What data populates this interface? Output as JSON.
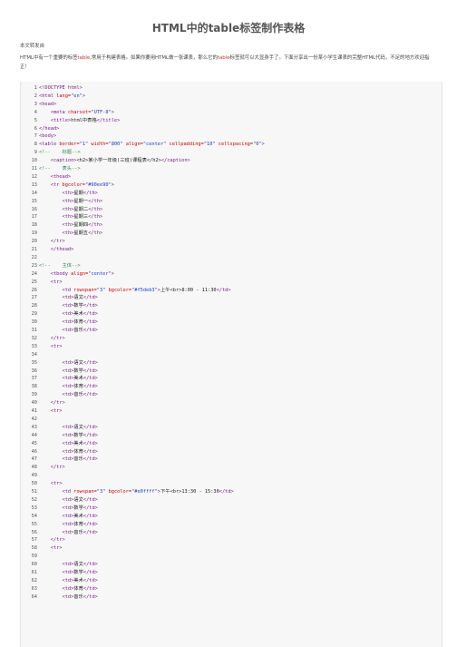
{
  "doc": {
    "title": "HTML中的table标签制作表格",
    "meta": "本文转发自",
    "intro_parts": [
      {
        "t": "HTML中有一个重要的标签",
        "c": ""
      },
      {
        "t": "table",
        "c": "red"
      },
      {
        "t": ",常用于构建表格。如果你要用HTML做一张课表，那么它的",
        "c": ""
      },
      {
        "t": "table",
        "c": "red"
      },
      {
        "t": "标签就可以大显身手了。下面分享出一份某小学生课表的完整HTML代码，不足的地方欢迎指正！",
        "c": ""
      }
    ]
  },
  "code_lines": [
    [
      [
        "tag",
        "<!DOCTYPE html>"
      ]
    ],
    [
      [
        "tag",
        "<html "
      ],
      [
        "attr",
        "lang="
      ],
      [
        "val",
        "\"en\""
      ],
      [
        "tag",
        ">"
      ]
    ],
    [
      [
        "tag",
        "<head>"
      ]
    ],
    [
      [
        "txt",
        "    "
      ],
      [
        "tag",
        "<meta "
      ],
      [
        "attr",
        "charset="
      ],
      [
        "val",
        "\"UTF-8\""
      ],
      [
        "tag",
        ">"
      ]
    ],
    [
      [
        "txt",
        "    "
      ],
      [
        "tag",
        "<title>"
      ],
      [
        "txt",
        "html中表格"
      ],
      [
        "tag",
        "</title>"
      ]
    ],
    [
      [
        "tag",
        "</head>"
      ]
    ],
    [
      [
        "tag",
        "<body>"
      ]
    ],
    [
      [
        "tag",
        "<table "
      ],
      [
        "attr",
        "border="
      ],
      [
        "val",
        "\"1\" "
      ],
      [
        "attr",
        "width="
      ],
      [
        "val",
        "\"800\" "
      ],
      [
        "attr",
        "align="
      ],
      [
        "val",
        "\"center\" "
      ],
      [
        "attr",
        "cellpadding="
      ],
      [
        "val",
        "\"10\" "
      ],
      [
        "attr",
        "cellspacing="
      ],
      [
        "val",
        "\"0\""
      ],
      [
        "tag",
        ">"
      ]
    ],
    [
      [
        "cmt",
        "<!--    标题-->"
      ]
    ],
    [
      [
        "txt",
        "    "
      ],
      [
        "tag",
        "<caption>"
      ],
      [
        "txt",
        "<h2>某小学一年级(三班)课程表</h2>"
      ],
      [
        "tag",
        "</caption>"
      ]
    ],
    [
      [
        "cmt",
        "<!--    表头-->"
      ]
    ],
    [
      [
        "txt",
        "    "
      ],
      [
        "tag",
        "<thead>"
      ]
    ],
    [
      [
        "txt",
        "    "
      ],
      [
        "tag",
        "<tr "
      ],
      [
        "attr",
        "bgcolor="
      ],
      [
        "val",
        "\"#90ee90\""
      ],
      [
        "tag",
        ">"
      ]
    ],
    [
      [
        "txt",
        "        "
      ],
      [
        "tag",
        "<th>"
      ],
      [
        "txt",
        "星期"
      ],
      [
        "tag",
        "</th>"
      ]
    ],
    [
      [
        "txt",
        "        "
      ],
      [
        "tag",
        "<th>"
      ],
      [
        "txt",
        "星期一"
      ],
      [
        "tag",
        "</th>"
      ]
    ],
    [
      [
        "txt",
        "        "
      ],
      [
        "tag",
        "<th>"
      ],
      [
        "txt",
        "星期二"
      ],
      [
        "tag",
        "</th>"
      ]
    ],
    [
      [
        "txt",
        "        "
      ],
      [
        "tag",
        "<th>"
      ],
      [
        "txt",
        "星期三"
      ],
      [
        "tag",
        "</th>"
      ]
    ],
    [
      [
        "txt",
        "        "
      ],
      [
        "tag",
        "<th>"
      ],
      [
        "txt",
        "星期四"
      ],
      [
        "tag",
        "</th>"
      ]
    ],
    [
      [
        "txt",
        "        "
      ],
      [
        "tag",
        "<th>"
      ],
      [
        "txt",
        "星期五"
      ],
      [
        "tag",
        "</th>"
      ]
    ],
    [
      [
        "txt",
        "    "
      ],
      [
        "tag",
        "</tr>"
      ]
    ],
    [
      [
        "txt",
        "    "
      ],
      [
        "tag",
        "</thead>"
      ]
    ],
    [],
    [
      [
        "cmt",
        "<!--    主体-->"
      ]
    ],
    [
      [
        "txt",
        "    "
      ],
      [
        "tag",
        "<tbody "
      ],
      [
        "attr",
        "align="
      ],
      [
        "val",
        "\"center\""
      ],
      [
        "tag",
        ">"
      ]
    ],
    [
      [
        "txt",
        "    "
      ],
      [
        "tag",
        "<tr>"
      ]
    ],
    [
      [
        "txt",
        "        "
      ],
      [
        "tag",
        "<td "
      ],
      [
        "attr",
        "rowspan="
      ],
      [
        "val",
        "\"3\" "
      ],
      [
        "attr",
        "bgcolor="
      ],
      [
        "val",
        "\"#f5deb3\""
      ],
      [
        "tag",
        ">"
      ],
      [
        "txt",
        "上午<br>8:00 - 11:30"
      ],
      [
        "tag",
        "</td>"
      ]
    ],
    [
      [
        "txt",
        "        "
      ],
      [
        "tag",
        "<td>"
      ],
      [
        "txt",
        "语文"
      ],
      [
        "tag",
        "</td>"
      ]
    ],
    [
      [
        "txt",
        "        "
      ],
      [
        "tag",
        "<td>"
      ],
      [
        "txt",
        "数学"
      ],
      [
        "tag",
        "</td>"
      ]
    ],
    [
      [
        "txt",
        "        "
      ],
      [
        "tag",
        "<td>"
      ],
      [
        "txt",
        "美术"
      ],
      [
        "tag",
        "</td>"
      ]
    ],
    [
      [
        "txt",
        "        "
      ],
      [
        "tag",
        "<td>"
      ],
      [
        "txt",
        "体育"
      ],
      [
        "tag",
        "</td>"
      ]
    ],
    [
      [
        "txt",
        "        "
      ],
      [
        "tag",
        "<td>"
      ],
      [
        "txt",
        "音乐"
      ],
      [
        "tag",
        "</td>"
      ]
    ],
    [
      [
        "txt",
        "    "
      ],
      [
        "tag",
        "</tr>"
      ]
    ],
    [
      [
        "txt",
        "    "
      ],
      [
        "tag",
        "<tr>"
      ]
    ],
    [],
    [
      [
        "txt",
        "        "
      ],
      [
        "tag",
        "<td>"
      ],
      [
        "txt",
        "语文"
      ],
      [
        "tag",
        "</td>"
      ]
    ],
    [
      [
        "txt",
        "        "
      ],
      [
        "tag",
        "<td>"
      ],
      [
        "txt",
        "数学"
      ],
      [
        "tag",
        "</td>"
      ]
    ],
    [
      [
        "txt",
        "        "
      ],
      [
        "tag",
        "<td>"
      ],
      [
        "txt",
        "美术"
      ],
      [
        "tag",
        "</td>"
      ]
    ],
    [
      [
        "txt",
        "        "
      ],
      [
        "tag",
        "<td>"
      ],
      [
        "txt",
        "体育"
      ],
      [
        "tag",
        "</td>"
      ]
    ],
    [
      [
        "txt",
        "        "
      ],
      [
        "tag",
        "<td>"
      ],
      [
        "txt",
        "音乐"
      ],
      [
        "tag",
        "</td>"
      ]
    ],
    [
      [
        "txt",
        "    "
      ],
      [
        "tag",
        "</tr>"
      ]
    ],
    [
      [
        "txt",
        "    "
      ],
      [
        "tag",
        "<tr>"
      ]
    ],
    [],
    [
      [
        "txt",
        "        "
      ],
      [
        "tag",
        "<td>"
      ],
      [
        "txt",
        "语文"
      ],
      [
        "tag",
        "</td>"
      ]
    ],
    [
      [
        "txt",
        "        "
      ],
      [
        "tag",
        "<td>"
      ],
      [
        "txt",
        "数学"
      ],
      [
        "tag",
        "</td>"
      ]
    ],
    [
      [
        "txt",
        "        "
      ],
      [
        "tag",
        "<td>"
      ],
      [
        "txt",
        "美术"
      ],
      [
        "tag",
        "</td>"
      ]
    ],
    [
      [
        "txt",
        "        "
      ],
      [
        "tag",
        "<td>"
      ],
      [
        "txt",
        "体育"
      ],
      [
        "tag",
        "</td>"
      ]
    ],
    [
      [
        "txt",
        "        "
      ],
      [
        "tag",
        "<td>"
      ],
      [
        "txt",
        "音乐"
      ],
      [
        "tag",
        "</td>"
      ]
    ],
    [
      [
        "txt",
        "    "
      ],
      [
        "tag",
        "</tr>"
      ]
    ],
    [],
    [
      [
        "txt",
        "    "
      ],
      [
        "tag",
        "<tr>"
      ]
    ],
    [
      [
        "txt",
        "        "
      ],
      [
        "tag",
        "<td "
      ],
      [
        "attr",
        "rowspan="
      ],
      [
        "val",
        "\"3\" "
      ],
      [
        "attr",
        "bgcolor="
      ],
      [
        "val",
        "\"#e0ffff\""
      ],
      [
        "tag",
        ">"
      ],
      [
        "txt",
        "下午<br>13:30 - 15:30"
      ],
      [
        "tag",
        "</td>"
      ]
    ],
    [
      [
        "txt",
        "        "
      ],
      [
        "tag",
        "<td>"
      ],
      [
        "txt",
        "语文"
      ],
      [
        "tag",
        "</td>"
      ]
    ],
    [
      [
        "txt",
        "        "
      ],
      [
        "tag",
        "<td>"
      ],
      [
        "txt",
        "数学"
      ],
      [
        "tag",
        "</td>"
      ]
    ],
    [
      [
        "txt",
        "        "
      ],
      [
        "tag",
        "<td>"
      ],
      [
        "txt",
        "美术"
      ],
      [
        "tag",
        "</td>"
      ]
    ],
    [
      [
        "txt",
        "        "
      ],
      [
        "tag",
        "<td>"
      ],
      [
        "txt",
        "体育"
      ],
      [
        "tag",
        "</td>"
      ]
    ],
    [
      [
        "txt",
        "        "
      ],
      [
        "tag",
        "<td>"
      ],
      [
        "txt",
        "音乐"
      ],
      [
        "tag",
        "</td>"
      ]
    ],
    [
      [
        "txt",
        "    "
      ],
      [
        "tag",
        "</tr>"
      ]
    ],
    [
      [
        "txt",
        "    "
      ],
      [
        "tag",
        "<tr>"
      ]
    ],
    [],
    [
      [
        "txt",
        "        "
      ],
      [
        "tag",
        "<td>"
      ],
      [
        "txt",
        "语文"
      ],
      [
        "tag",
        "</td>"
      ]
    ],
    [
      [
        "txt",
        "        "
      ],
      [
        "tag",
        "<td>"
      ],
      [
        "txt",
        "数学"
      ],
      [
        "tag",
        "</td>"
      ]
    ],
    [
      [
        "txt",
        "        "
      ],
      [
        "tag",
        "<td>"
      ],
      [
        "txt",
        "美术"
      ],
      [
        "tag",
        "</td>"
      ]
    ],
    [
      [
        "txt",
        "        "
      ],
      [
        "tag",
        "<td>"
      ],
      [
        "txt",
        "体育"
      ],
      [
        "tag",
        "</td>"
      ]
    ],
    [
      [
        "txt",
        "        "
      ],
      [
        "tag",
        "<td>"
      ],
      [
        "txt",
        "音乐"
      ],
      [
        "tag",
        "</td>"
      ]
    ]
  ],
  "colors": {
    "tag": "#7a1a8a",
    "attr": "#cc0000",
    "val": "#1a3dc7",
    "comment": "#2e8b57",
    "code_bg": "#f7f7f7"
  }
}
